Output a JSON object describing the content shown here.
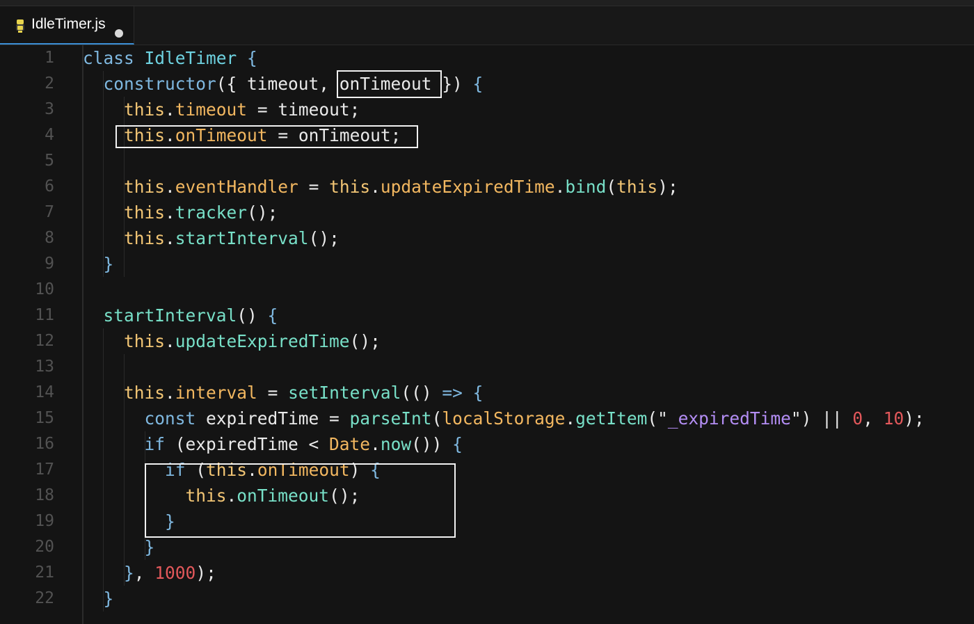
{
  "tab": {
    "filename": "IdleTimer.js",
    "icon": "js-file-icon",
    "unsaved_indicator": "dot"
  },
  "editor": {
    "line_numbers": [
      "1",
      "2",
      "3",
      "4",
      "5",
      "6",
      "7",
      "8",
      "9",
      "10",
      "11",
      "12",
      "13",
      "14",
      "15",
      "16",
      "17",
      "18",
      "19",
      "20",
      "21",
      "22"
    ],
    "lines": [
      [
        {
          "t": "class ",
          "c": "kw"
        },
        {
          "t": "IdleTimer ",
          "c": "cls"
        },
        {
          "t": "{",
          "c": "brace"
        }
      ],
      [
        {
          "t": "  "
        },
        {
          "t": "constructor",
          "c": "kw"
        },
        {
          "t": "({ timeout, onTimeout }) "
        },
        {
          "t": "{",
          "c": "brace"
        }
      ],
      [
        {
          "t": "    "
        },
        {
          "t": "this",
          "c": "this"
        },
        {
          "t": "."
        },
        {
          "t": "timeout",
          "c": "prop"
        },
        {
          "t": " = timeout;"
        }
      ],
      [
        {
          "t": "    "
        },
        {
          "t": "this",
          "c": "this"
        },
        {
          "t": "."
        },
        {
          "t": "onTimeout",
          "c": "prop"
        },
        {
          "t": " = onTimeout;"
        }
      ],
      [
        {
          "t": ""
        }
      ],
      [
        {
          "t": "    "
        },
        {
          "t": "this",
          "c": "this"
        },
        {
          "t": "."
        },
        {
          "t": "eventHandler",
          "c": "prop"
        },
        {
          "t": " = "
        },
        {
          "t": "this",
          "c": "this"
        },
        {
          "t": "."
        },
        {
          "t": "updateExpiredTime",
          "c": "prop"
        },
        {
          "t": "."
        },
        {
          "t": "bind",
          "c": "fn"
        },
        {
          "t": "("
        },
        {
          "t": "this",
          "c": "this"
        },
        {
          "t": ");"
        }
      ],
      [
        {
          "t": "    "
        },
        {
          "t": "this",
          "c": "this"
        },
        {
          "t": "."
        },
        {
          "t": "tracker",
          "c": "fn"
        },
        {
          "t": "();"
        }
      ],
      [
        {
          "t": "    "
        },
        {
          "t": "this",
          "c": "this"
        },
        {
          "t": "."
        },
        {
          "t": "startInterval",
          "c": "fn"
        },
        {
          "t": "();"
        }
      ],
      [
        {
          "t": "  "
        },
        {
          "t": "}",
          "c": "brace"
        }
      ],
      [
        {
          "t": ""
        }
      ],
      [
        {
          "t": "  "
        },
        {
          "t": "startInterval",
          "c": "fn"
        },
        {
          "t": "() "
        },
        {
          "t": "{",
          "c": "brace"
        }
      ],
      [
        {
          "t": "    "
        },
        {
          "t": "this",
          "c": "this"
        },
        {
          "t": "."
        },
        {
          "t": "updateExpiredTime",
          "c": "fn"
        },
        {
          "t": "();"
        }
      ],
      [
        {
          "t": ""
        }
      ],
      [
        {
          "t": "    "
        },
        {
          "t": "this",
          "c": "this"
        },
        {
          "t": "."
        },
        {
          "t": "interval",
          "c": "prop"
        },
        {
          "t": " = "
        },
        {
          "t": "setInterval",
          "c": "fn"
        },
        {
          "t": "(() "
        },
        {
          "t": "=>",
          "c": "kw"
        },
        {
          "t": " "
        },
        {
          "t": "{",
          "c": "brace"
        }
      ],
      [
        {
          "t": "      "
        },
        {
          "t": "const",
          "c": "kw"
        },
        {
          "t": " expiredTime = "
        },
        {
          "t": "parseInt",
          "c": "fn"
        },
        {
          "t": "("
        },
        {
          "t": "localStorage",
          "c": "prop"
        },
        {
          "t": "."
        },
        {
          "t": "getItem",
          "c": "fn"
        },
        {
          "t": "(\""
        },
        {
          "t": "_expiredTime",
          "c": "str"
        },
        {
          "t": "\") || "
        },
        {
          "t": "0",
          "c": "num"
        },
        {
          "t": ", "
        },
        {
          "t": "10",
          "c": "num"
        },
        {
          "t": ");"
        }
      ],
      [
        {
          "t": "      "
        },
        {
          "t": "if",
          "c": "kw"
        },
        {
          "t": " (expiredTime < "
        },
        {
          "t": "Date",
          "c": "prop"
        },
        {
          "t": "."
        },
        {
          "t": "now",
          "c": "fn"
        },
        {
          "t": "()) "
        },
        {
          "t": "{",
          "c": "brace"
        }
      ],
      [
        {
          "t": "        "
        },
        {
          "t": "if",
          "c": "kw"
        },
        {
          "t": " ("
        },
        {
          "t": "this",
          "c": "this"
        },
        {
          "t": "."
        },
        {
          "t": "onTimeout",
          "c": "prop"
        },
        {
          "t": ") "
        },
        {
          "t": "{",
          "c": "brace"
        }
      ],
      [
        {
          "t": "          "
        },
        {
          "t": "this",
          "c": "this"
        },
        {
          "t": "."
        },
        {
          "t": "onTimeout",
          "c": "fn"
        },
        {
          "t": "();"
        }
      ],
      [
        {
          "t": "        "
        },
        {
          "t": "}",
          "c": "brace"
        }
      ],
      [
        {
          "t": "      "
        },
        {
          "t": "}",
          "c": "brace"
        }
      ],
      [
        {
          "t": "    "
        },
        {
          "t": "}",
          "c": "brace"
        },
        {
          "t": ", "
        },
        {
          "t": "1000",
          "c": "num"
        },
        {
          "t": ");"
        }
      ],
      [
        {
          "t": "  "
        },
        {
          "t": "}",
          "c": "brace"
        }
      ]
    ]
  }
}
